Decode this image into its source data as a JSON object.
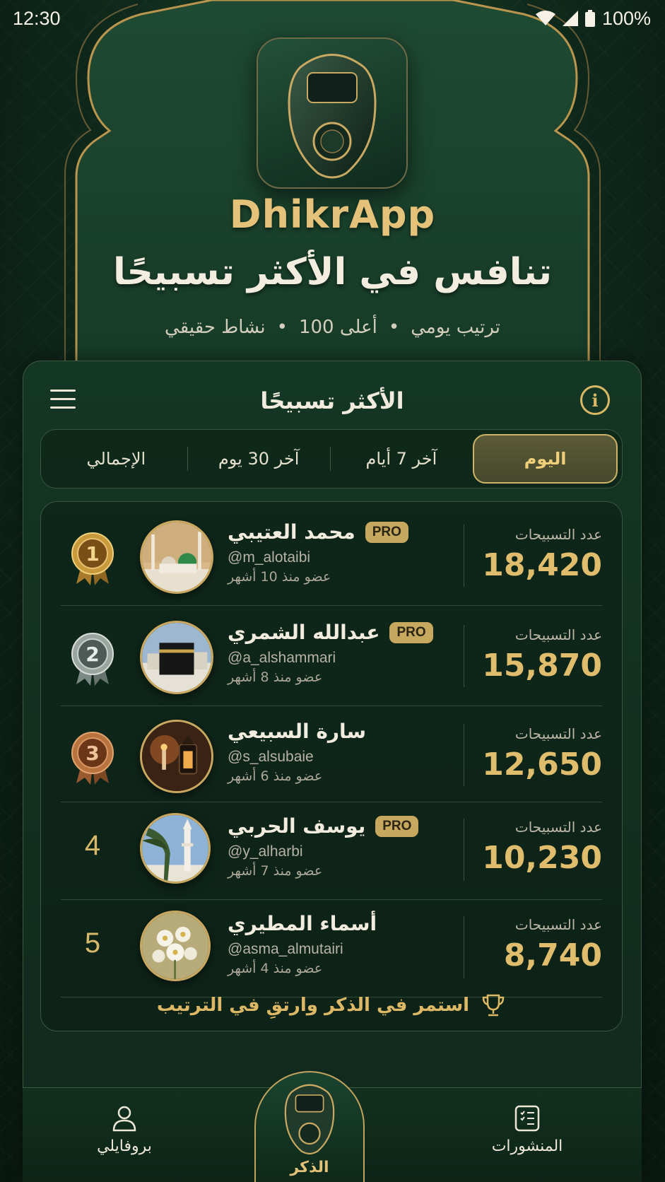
{
  "status": {
    "time": "12:30",
    "battery": "100%"
  },
  "hero": {
    "brand": "DhikrApp",
    "title": "تنافس في الأكثر تسبيحًا",
    "features": [
      "ترتيب يومي",
      "أعلى 100",
      "نشاط حقيقي"
    ]
  },
  "panel": {
    "title": "الأكثر تسبيحًا",
    "tabs": [
      {
        "label": "اليوم",
        "active": true
      },
      {
        "label": "آخر 7 أيام",
        "active": false
      },
      {
        "label": "آخر 30 يوم",
        "active": false
      },
      {
        "label": "الإجمالي",
        "active": false
      }
    ]
  },
  "leaderboard": {
    "score_label": "عدد التسبيحات",
    "pro_label": "PRO",
    "rows": [
      {
        "rank": "1",
        "name": "محمد العتيبي",
        "pro": true,
        "handle": "@m_alotaibi",
        "member": "عضو منذ 10 أشهر",
        "score": "18,420",
        "avatar": "mosque-madinah"
      },
      {
        "rank": "2",
        "name": "عبدالله الشمري",
        "pro": true,
        "handle": "@a_alshammari",
        "member": "عضو منذ 8 أشهر",
        "score": "15,870",
        "avatar": "kaaba"
      },
      {
        "rank": "3",
        "name": "سارة السبيعي",
        "pro": false,
        "handle": "@s_alsubaie",
        "member": "عضو منذ 6 أشهر",
        "score": "12,650",
        "avatar": "lantern"
      },
      {
        "rank": "4",
        "name": "يوسف الحربي",
        "pro": true,
        "handle": "@y_alharbi",
        "member": "عضو منذ 7 أشهر",
        "score": "10,230",
        "avatar": "palm-minaret"
      },
      {
        "rank": "5",
        "name": "أسماء المطيري",
        "pro": false,
        "handle": "@asma_almutairi",
        "member": "عضو منذ 4 أشهر",
        "score": "8,740",
        "avatar": "flowers"
      }
    ],
    "footer": "استمر في الذكر وارتقِ في الترتيب"
  },
  "nav": {
    "profile": "بروفايلي",
    "dhikr": "الذكر",
    "posts": "المنشورات"
  },
  "colors": {
    "gold": "#d8b96c",
    "bg": "#0f2a1c",
    "panel": "#143624"
  }
}
